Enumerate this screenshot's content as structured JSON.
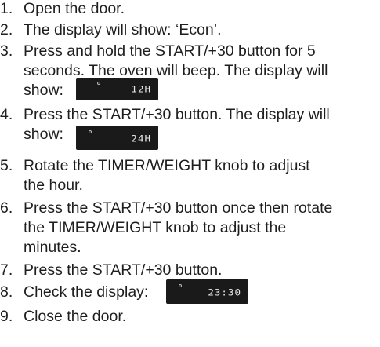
{
  "steps": [
    {
      "number": "1.",
      "lines": [
        "Open the door."
      ]
    },
    {
      "number": "2.",
      "lines": [
        "The display will show: ‘Econ’."
      ]
    },
    {
      "number": "3.",
      "lines": [
        "Press and hold the START/+30 button for 5",
        "seconds. The oven will beep. The display will",
        "show:"
      ],
      "display": "12H"
    },
    {
      "number": "4.",
      "lines": [
        "Press the START/+30 button. The display will",
        "show:"
      ],
      "display": "24H"
    },
    {
      "number": "5.",
      "lines": [
        "Rotate the TIMER/WEIGHT knob to adjust",
        "the hour."
      ]
    },
    {
      "number": "6.",
      "lines": [
        "Press the START/+30 button once then rotate",
        "the TIMER/WEIGHT knob to adjust the",
        "minutes."
      ]
    },
    {
      "number": "7.",
      "lines": [
        "Press the START/+30 button."
      ]
    },
    {
      "number": "8.",
      "lines": [
        "Check the display:"
      ],
      "display": "23:30"
    },
    {
      "number": "9.",
      "lines": [
        "Close the door."
      ]
    }
  ]
}
